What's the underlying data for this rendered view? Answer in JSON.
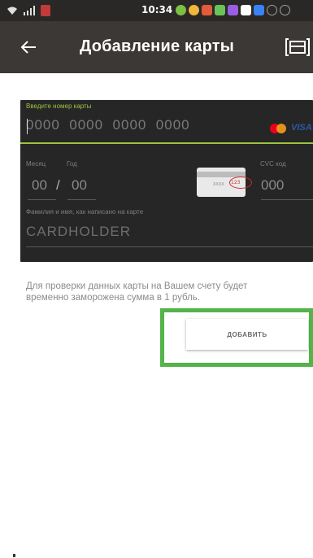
{
  "status_bar": {
    "time": "10:34",
    "icons": [
      "wifi-icon",
      "signal-icon",
      "app-flag-icon"
    ],
    "notification_colors": [
      "#7bc043",
      "#f0b73a",
      "#e25b3a",
      "#6ac259",
      "#9b5de5",
      "#ffffff",
      "#3b82f6",
      "#9e9e9e",
      "#9e9e9e"
    ]
  },
  "app_bar": {
    "back_icon": "arrow-left-icon",
    "title": "Добавление карты",
    "scan_icon": "scan-card-icon"
  },
  "card_form": {
    "number_label": "Введите номер карты",
    "number_placeholder": "0000  0000  0000  0000",
    "brands": {
      "mastercard": "mastercard-icon",
      "visa": "VISA"
    },
    "month_label": "Месяц",
    "year_label": "Год",
    "month_placeholder": "00",
    "separator": "/",
    "year_placeholder": "00",
    "cvc_label": "CVC код",
    "cvc_placeholder": "000",
    "card_back_mask": "XXXX",
    "card_back_cvc": "123",
    "cardholder_label": "Фамилия и имя, как написано на карте",
    "cardholder_placeholder": "CARDHOLDER"
  },
  "info_text": "Для проверки данных карты на Вашем счету будет временно заморожена сумма в 1 рубль.",
  "add_button_label": "ДОБАВИТЬ",
  "colors": {
    "accent_green": "#9cc43c",
    "highlight_green": "#54b34a",
    "app_bar": "#3b3835"
  }
}
